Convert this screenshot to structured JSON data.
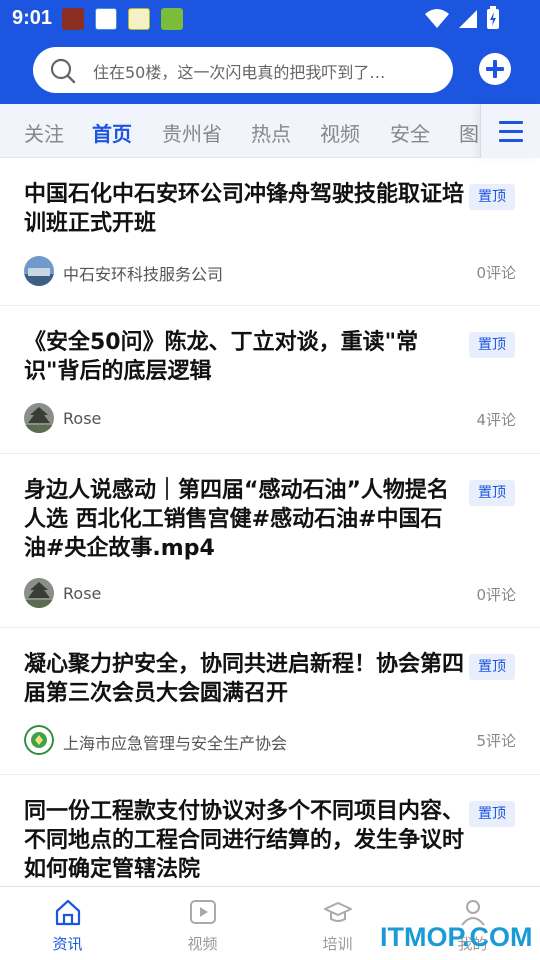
{
  "status_bar": {
    "time": "9:01"
  },
  "search": {
    "placeholder": "住在50楼，这一次闪电真的把我吓到了…"
  },
  "tabs": [
    "关注",
    "首页",
    "贵州省",
    "热点",
    "视频",
    "安全",
    "图"
  ],
  "active_tab": "首页",
  "feed": [
    {
      "title": "中国石化中石安环公司冲锋舟驾驶技能取证培训班正式开班",
      "badge": "置顶",
      "source": "中石安环科技服务公司",
      "comments": "0评论"
    },
    {
      "title": "《安全50问》陈龙、丁立对谈，重读\"常识\"背后的底层逻辑",
      "badge": "置顶",
      "source": "Rose",
      "comments": "4评论"
    },
    {
      "title": "身边人说感动｜第四届“感动石油”人物提名人选 西北化工销售宫健#感动石油#中国石油#央企故事.mp4",
      "badge": "置顶",
      "source": "Rose",
      "comments": "0评论"
    },
    {
      "title": "凝心聚力护安全，协同共进启新程！协会第四届第三次会员大会圆满召开",
      "badge": "置顶",
      "source": "上海市应急管理与安全生产协会",
      "comments": "5评论"
    },
    {
      "title": "同一份工程款支付协议对多个不同项目内容、不同地点的工程合同进行结算的，发生争议时如何确定管辖法院",
      "badge": "置顶"
    }
  ],
  "bottom_nav": [
    {
      "label": "资讯",
      "icon": "home-icon",
      "active": true
    },
    {
      "label": "视频",
      "icon": "play-icon",
      "active": false
    },
    {
      "label": "培训",
      "icon": "graduation-cap-icon",
      "active": false
    },
    {
      "label": "我的",
      "icon": "person-icon",
      "active": false
    }
  ],
  "watermark": "ITMOP.COM",
  "colors": {
    "brand": "#1c56e0",
    "badge_bg": "#e8eefc",
    "watermark": "#1a9bd7"
  }
}
